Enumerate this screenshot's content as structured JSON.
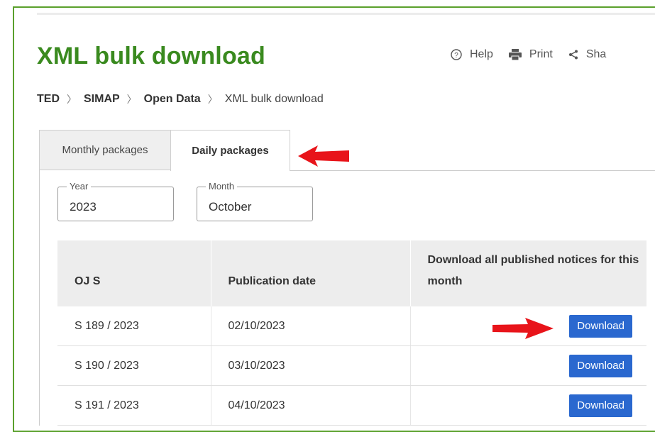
{
  "page": {
    "title": "XML bulk download",
    "actions": [
      {
        "label": "Help",
        "icon": "help-icon"
      },
      {
        "label": "Print",
        "icon": "print-icon"
      },
      {
        "label": "Sha",
        "icon": "share-icon"
      }
    ],
    "breadcrumb": [
      "TED",
      "SIMAP",
      "Open Data",
      "XML bulk download"
    ]
  },
  "tabs": [
    {
      "label": "Monthly packages",
      "active": false
    },
    {
      "label": "Daily packages",
      "active": true
    }
  ],
  "filters": {
    "year": {
      "legend": "Year",
      "value": "2023"
    },
    "month": {
      "legend": "Month",
      "value": "October"
    }
  },
  "table": {
    "headers": [
      "OJ S",
      "Publication date",
      "Download all published notices for this month"
    ],
    "rows": [
      {
        "oj": "S 189 / 2023",
        "date": "02/10/2023",
        "action": "Download"
      },
      {
        "oj": "S 190 / 2023",
        "date": "03/10/2023",
        "action": "Download"
      },
      {
        "oj": "S 191 / 2023",
        "date": "04/10/2023",
        "action": "Download"
      }
    ]
  },
  "colors": {
    "frame": "#5aa02c",
    "title": "#3a8a1f",
    "button": "#2a68cf",
    "annotation_arrow": "#e8141a"
  }
}
